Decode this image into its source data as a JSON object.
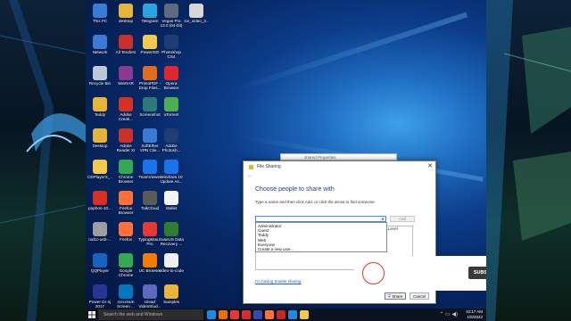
{
  "desktop": {
    "icons": [
      {
        "label": "This PC",
        "color": "#3a7bd5"
      },
      {
        "label": "desktop",
        "color": "#e8b339"
      },
      {
        "label": "Telegram",
        "color": "#2aa3e0"
      },
      {
        "label": "Vegas Pro 13.0 (64-bit)",
        "color": "#5b6b7d"
      },
      {
        "label": "ice_video_2...",
        "color": "#d8d8d8"
      },
      {
        "label": "Network",
        "color": "#3a7bd5"
      },
      {
        "label": "All Tenders",
        "color": "#c9302c"
      },
      {
        "label": "PowerISO",
        "color": "#f2c94c"
      },
      {
        "label": "Photoshop CS4",
        "color": "#1f3d75"
      },
      {
        "label": "Recycle Bin",
        "color": "#bcc9d6"
      },
      {
        "label": "WinRAR",
        "color": "#8a3b8f"
      },
      {
        "label": "PrimoPDF - Drop Files...",
        "color": "#e06d1f"
      },
      {
        "label": "Opera Browser",
        "color": "#e0262e"
      },
      {
        "label": "Teddy",
        "color": "#e8b339"
      },
      {
        "label": "Adobe Creati...",
        "color": "#d93025"
      },
      {
        "label": "Screenshot",
        "color": "#2b7a78"
      },
      {
        "label": "uTorrent",
        "color": "#4caf50"
      },
      {
        "label": "Desktop",
        "color": "#e8b339"
      },
      {
        "label": "Adobe Reader XI",
        "color": "#c9302c"
      },
      {
        "label": "SoftEther VPN Clie...",
        "color": "#3a7bd5"
      },
      {
        "label": "Adobe Photosh...",
        "color": "#1f3d75"
      },
      {
        "label": "CDPlayerX_...",
        "color": "#f2c94c"
      },
      {
        "label": "Chrome Browser",
        "color": "#34a853"
      },
      {
        "label": "TeamViewer",
        "color": "#1a73e8"
      },
      {
        "label": "Windows 10 Update As...",
        "color": "#1a73e8"
      },
      {
        "label": "pophon-10...",
        "color": "#d93025"
      },
      {
        "label": "Firefox Browser",
        "color": "#ff7139"
      },
      {
        "label": "TalkCloud",
        "color": "#5a5a5a"
      },
      {
        "label": "Wallet",
        "color": "#f5f5f5"
      },
      {
        "label": "nafcc-usb-...",
        "color": "#9e9e9e"
      },
      {
        "label": "Firefox",
        "color": "#ff7139"
      },
      {
        "label": "TypingMas... Pro",
        "color": "#e53935"
      },
      {
        "label": "EaseUS Data Recovery ...",
        "color": "#2e7d32"
      },
      {
        "label": "QQPlayer",
        "color": "#1565c0"
      },
      {
        "label": "Google Chrome",
        "color": "#34a853"
      },
      {
        "label": "UC Browser",
        "color": "#f57c00"
      },
      {
        "label": "video-to-code",
        "color": "#eeeeee"
      },
      {
        "label": "Power Gr ej 2017",
        "color": "#283593"
      },
      {
        "label": "Icecream Screen ...",
        "color": "#0277bd"
      },
      {
        "label": "Ulead VideoStud...",
        "color": "#5c6bc0"
      },
      {
        "label": "Samples",
        "color": "#e8b339"
      }
    ]
  },
  "background_window": {
    "title": "shared Properties"
  },
  "dialog": {
    "title": "File Sharing",
    "heading": "Choose people to share with",
    "instruction": "Type a name and then click Add, or click the arrow to find someone.",
    "input_value": "",
    "add_label": "Add",
    "permission_header": "Level",
    "dropdown_options": [
      "Administrator",
      "Guest",
      "Teddy",
      "Web",
      "Everyone",
      "Create a new user..."
    ],
    "help_link": "I'm having trouble sharing",
    "share_label": "Share",
    "cancel_label": "Cancel"
  },
  "taskbar": {
    "search_placeholder": "Search the web and Windows",
    "time": "10:17 AM",
    "date": "1/6/2022",
    "apps": [
      "#1e88e5",
      "#ef6c00",
      "#e53935",
      "#d32f2f",
      "#3949ab",
      "#ff7139",
      "#c62828",
      "#1e88e5",
      "#f2c94c"
    ]
  },
  "overlay": {
    "subscribe_label": "SUBSCRIBED",
    "accent": "#e33232"
  },
  "colors": {
    "accent": "#1a5bd0",
    "dialog_heading": "#1a3f8a"
  }
}
